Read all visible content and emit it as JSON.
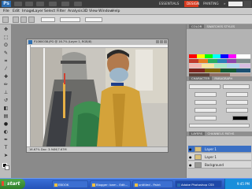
{
  "app": {
    "logo": "Ps",
    "workspaces": [
      "ESSENTIALS",
      "DESIGN",
      "PAINTING",
      "»"
    ],
    "active_workspace": "DESIGN"
  },
  "menu": [
    "File",
    "Edit",
    "Image",
    "Layer",
    "Select",
    "Filter",
    "Analysis",
    "3D",
    "View",
    "Window",
    "Help"
  ],
  "document": {
    "title": "P1060038.JPG @ 16.7% (Layer 1, RGB/8)",
    "status": "16.67%   Doc: 3.94M/7.67M"
  },
  "panels": {
    "color_tabs": [
      "COLOR",
      "SWATCHES",
      "STYLES"
    ],
    "character_tabs": [
      "CHARACTER",
      "PARAGRAPH"
    ],
    "layers_tabs": [
      "LAYERS",
      "CHANNELS",
      "PATHS"
    ],
    "layers": [
      {
        "name": "Layer 1",
        "selected": true
      },
      {
        "name": "Layer 1",
        "selected": false
      },
      {
        "name": "Background",
        "selected": false
      }
    ]
  },
  "taskbar": {
    "start": "start",
    "tasks": [
      {
        "label": "EBOOK",
        "active": false
      },
      {
        "label": "Blogger: bam - Edit...",
        "active": false
      },
      {
        "label": "untitled - Paint",
        "active": false
      },
      {
        "label": "Adobe Photoshop CS5",
        "active": true
      }
    ],
    "clock": "9:45 PM"
  }
}
